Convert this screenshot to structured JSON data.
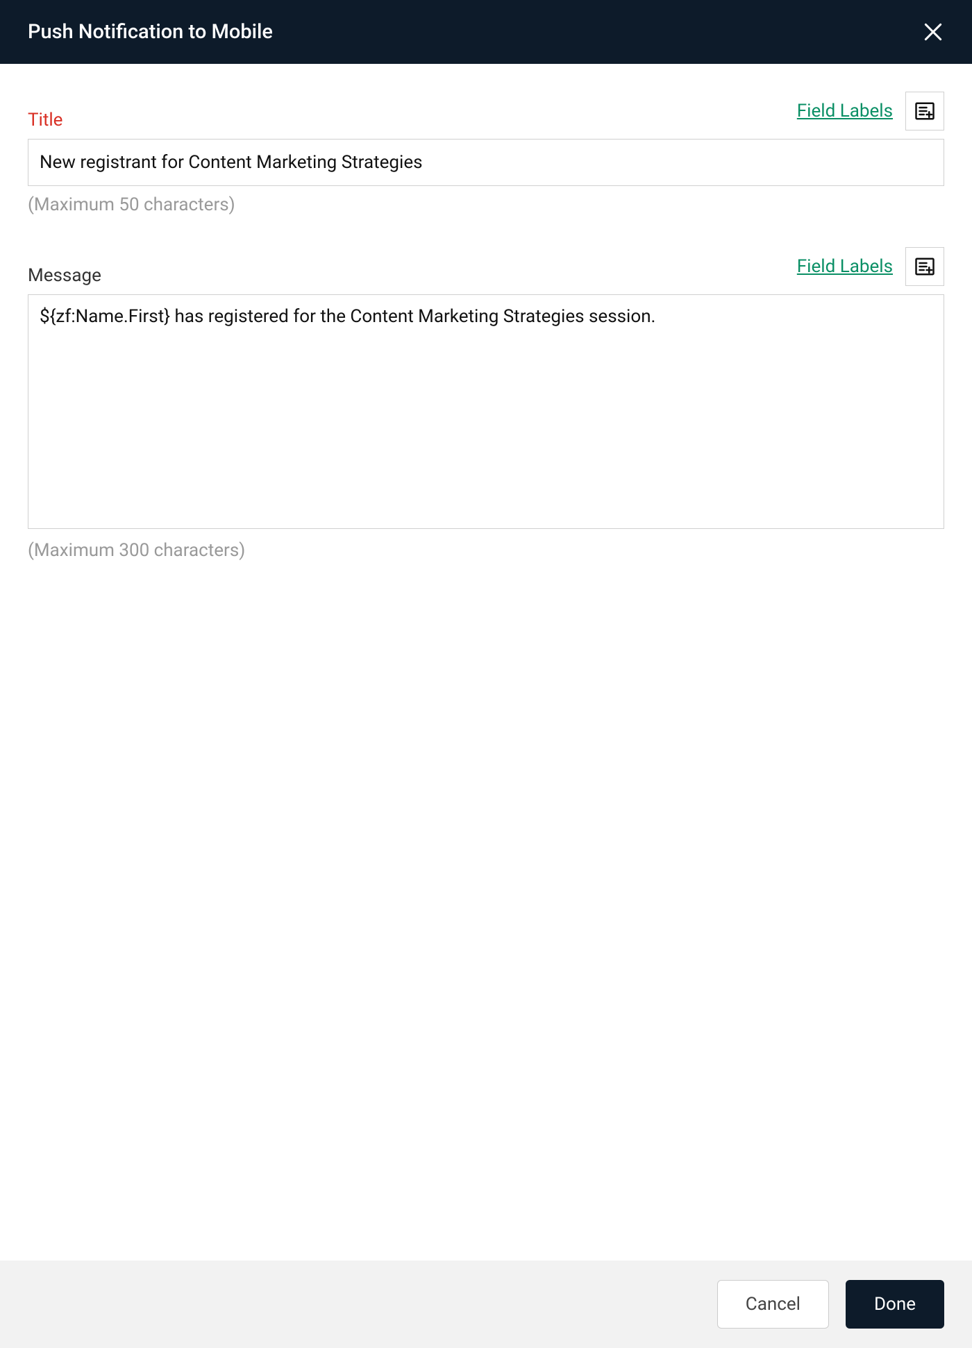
{
  "header": {
    "title": "Push Notification to Mobile"
  },
  "titleSection": {
    "label": "Title",
    "fieldLabelsLink": "Field Labels",
    "value": "New registrant for Content Marketing Strategies",
    "helper": "(Maximum 50 characters)"
  },
  "messageSection": {
    "label": "Message",
    "fieldLabelsLink": "Field Labels",
    "value": "${zf:Name.First} has registered for the Content Marketing Strategies session.",
    "helper": "(Maximum 300 characters)"
  },
  "footer": {
    "cancelLabel": "Cancel",
    "doneLabel": "Done"
  }
}
